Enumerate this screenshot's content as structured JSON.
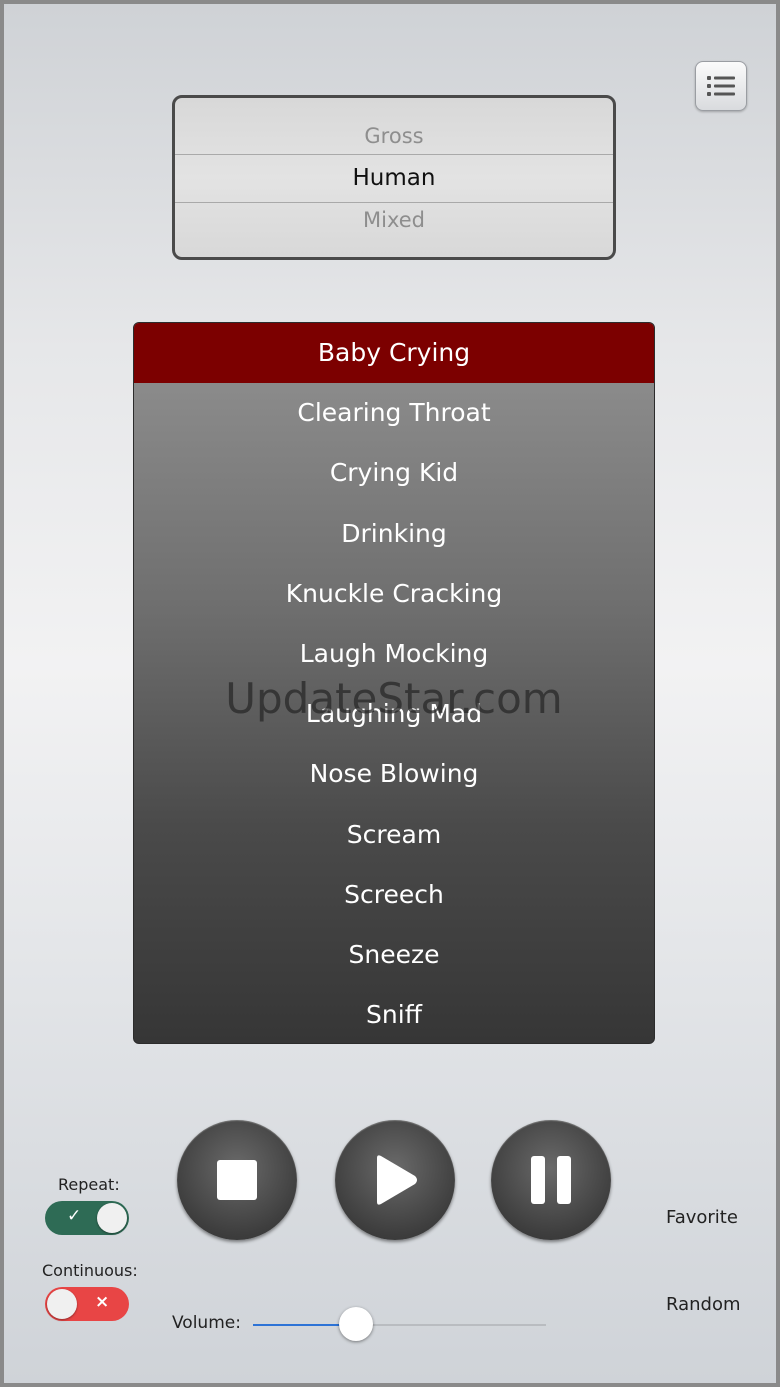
{
  "category_picker": {
    "above": "Gross",
    "selected": "Human",
    "below": "Mixed"
  },
  "sounds": [
    "Baby Crying",
    "Clearing Throat",
    "Crying Kid",
    "Drinking",
    "Knuckle Cracking",
    "Laugh Mocking",
    "Laughing Mad",
    "Nose Blowing",
    "Scream",
    "Screech",
    "Sneeze",
    "Sniff"
  ],
  "selected_sound": "Baby Crying",
  "watermark": "UpdateStar.com",
  "controls": {
    "repeat_label": "Repeat:",
    "repeat_mark": "✓",
    "continuous_label": "Continuous:",
    "continuous_mark": "×",
    "volume_label": "Volume:",
    "volume_level": 0.35,
    "favorite_label": "Favorite",
    "random_label": "Random"
  },
  "colors": {
    "selected_row": "#7c0000",
    "toggle_on": "#2e6b55",
    "toggle_off": "#e84545",
    "slider_fill": "#2d73d6"
  }
}
